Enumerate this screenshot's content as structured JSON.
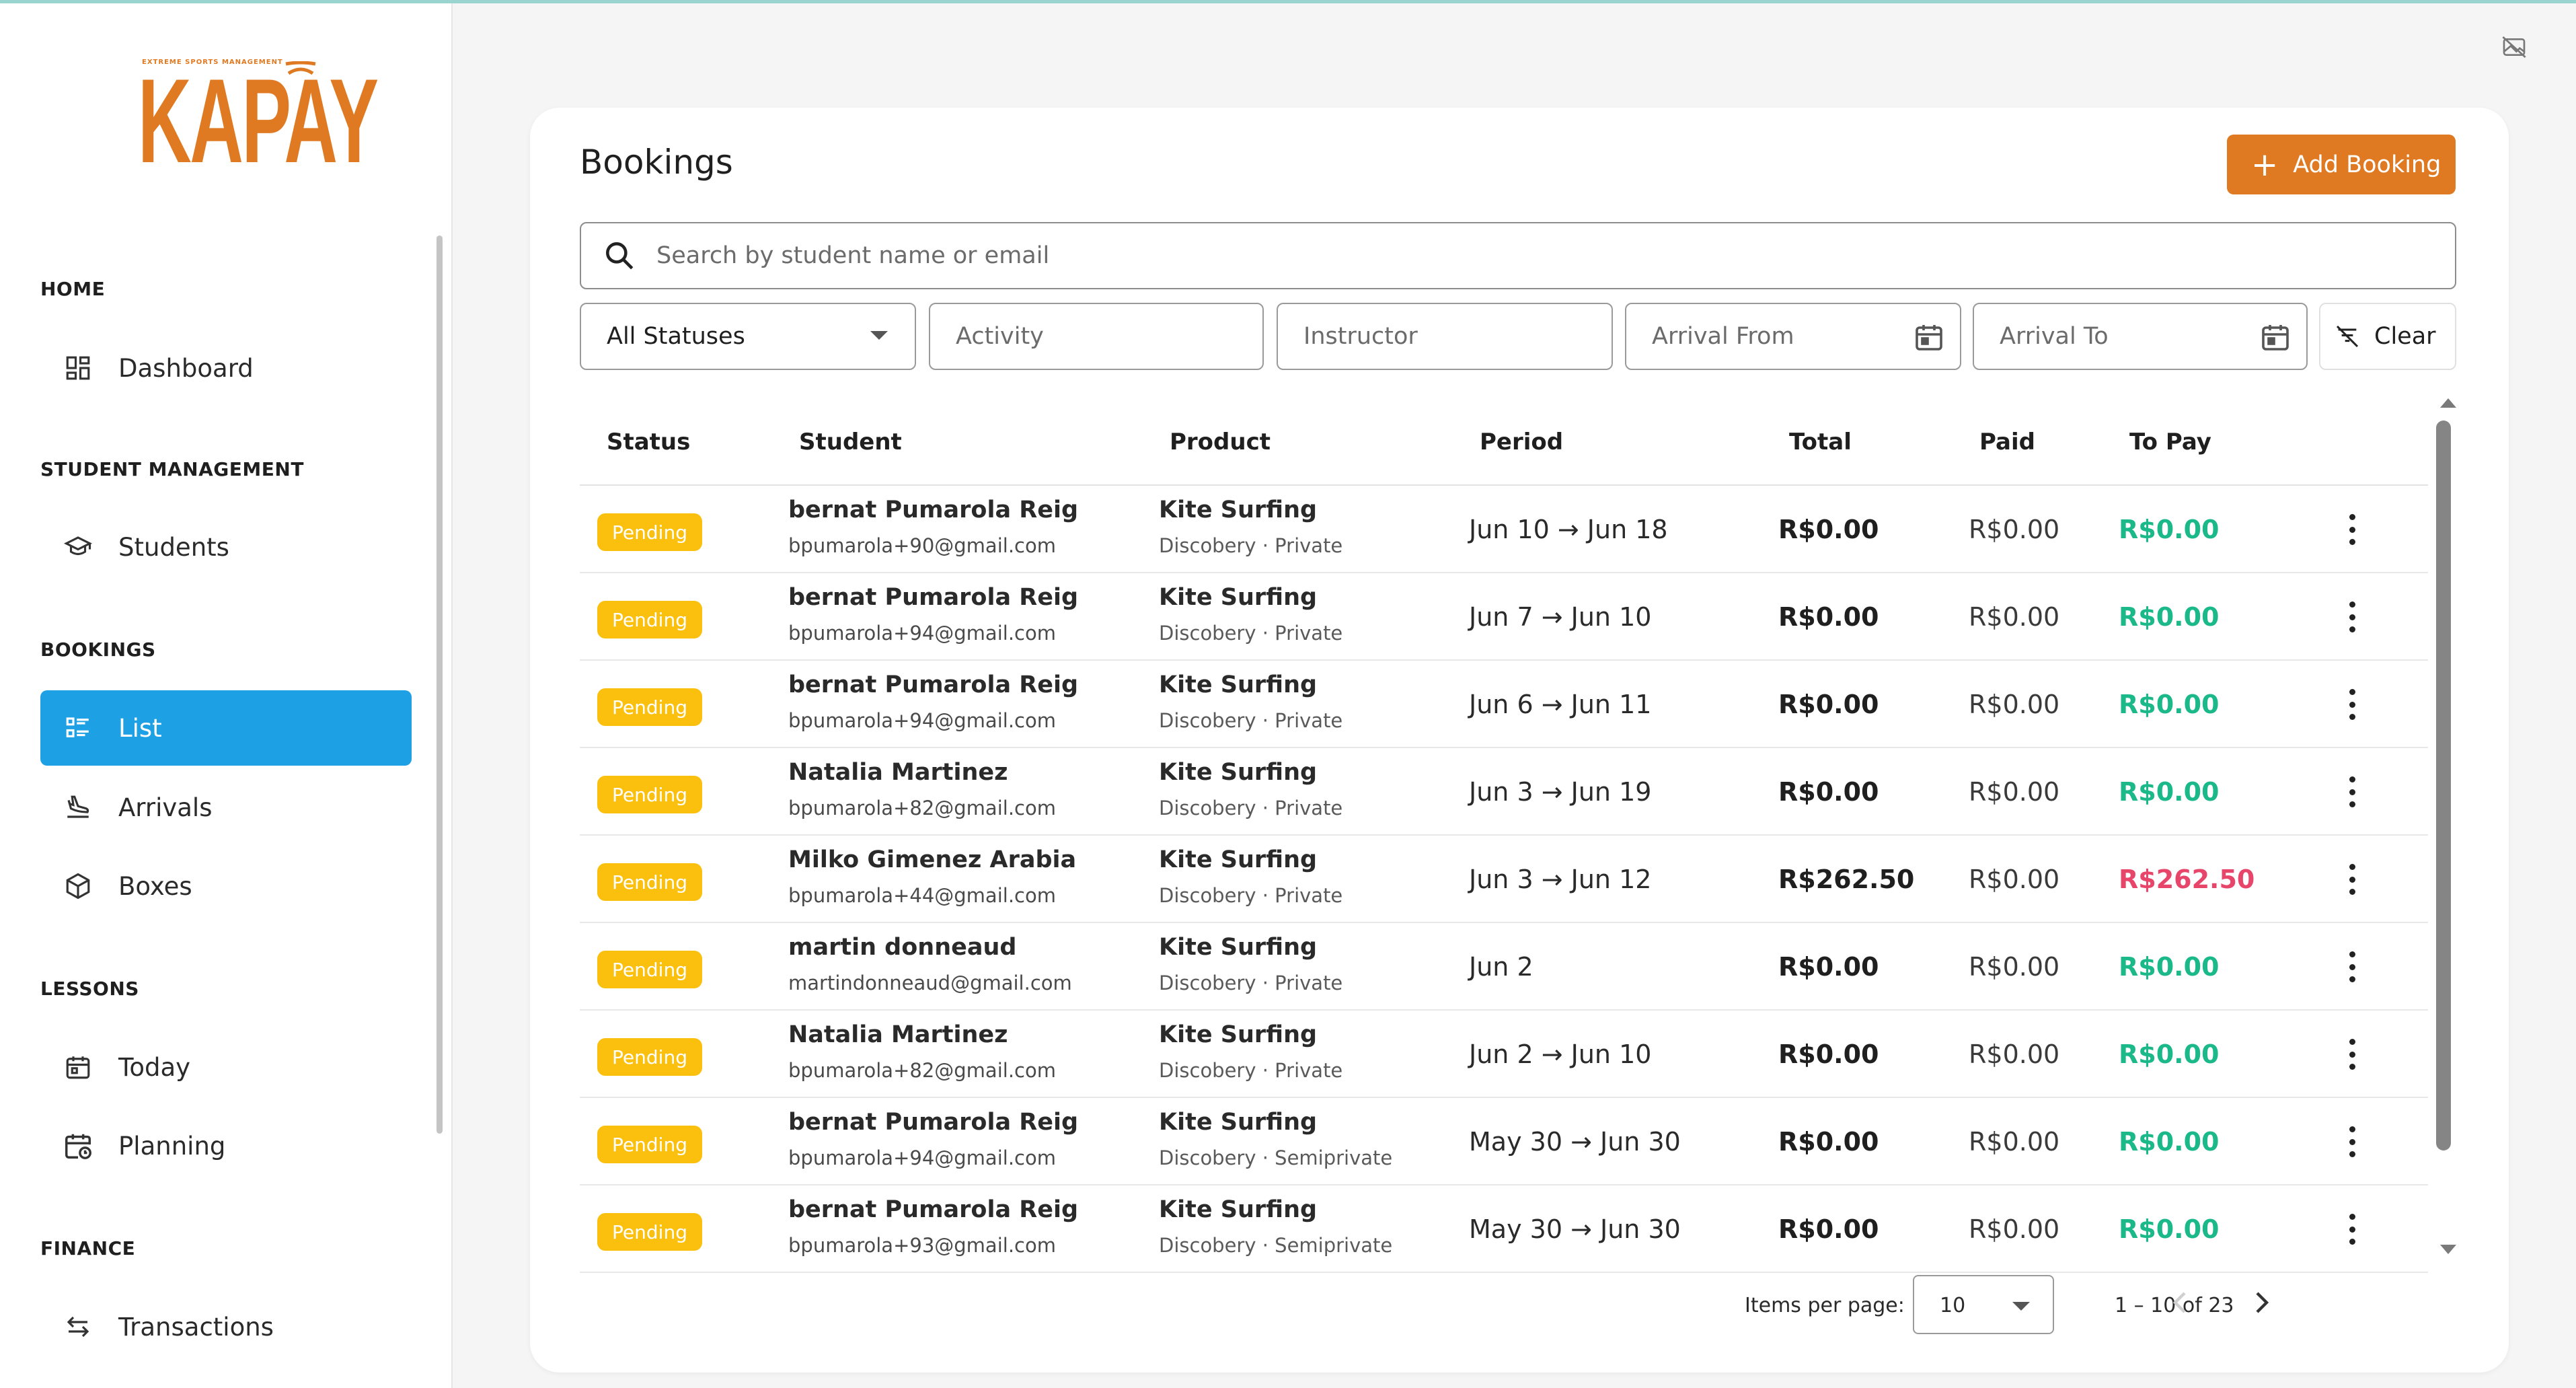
{
  "brand": {
    "tagline": "EXTREME SPORTS MANAGEMENT",
    "name": "KAPAY",
    "color": "#e07a22"
  },
  "sidebar": {
    "sections": [
      {
        "title": "HOME",
        "items": [
          {
            "label": "Dashboard",
            "icon": "dashboard-icon"
          }
        ]
      },
      {
        "title": "STUDENT MANAGEMENT",
        "items": [
          {
            "label": "Students",
            "icon": "graduation-cap-icon"
          }
        ]
      },
      {
        "title": "BOOKINGS",
        "items": [
          {
            "label": "List",
            "icon": "list-icon",
            "active": true
          },
          {
            "label": "Arrivals",
            "icon": "plane-landing-icon"
          },
          {
            "label": "Boxes",
            "icon": "box-icon"
          }
        ]
      },
      {
        "title": "LESSONS",
        "items": [
          {
            "label": "Today",
            "icon": "calendar-icon"
          },
          {
            "label": "Planning",
            "icon": "calendar-clock-icon"
          }
        ]
      },
      {
        "title": "FINANCE",
        "items": [
          {
            "label": "Transactions",
            "icon": "swap-arrows-icon"
          }
        ]
      }
    ]
  },
  "page": {
    "title": "Bookings",
    "add_button": "Add Booking",
    "search_placeholder": "Search by student name or email",
    "filters": {
      "status": "All Statuses",
      "activity": "Activity",
      "instructor": "Instructor",
      "arrival_from": "Arrival From",
      "arrival_to": "Arrival To",
      "clear": "Clear"
    }
  },
  "table": {
    "columns": [
      "Status",
      "Student",
      "Product",
      "Period",
      "Total",
      "Paid",
      "To Pay"
    ],
    "rows": [
      {
        "status": "Pending",
        "student": "bernat Pumarola Reig",
        "email": "bpumarola+90@gmail.com",
        "product": "Kite Surfing",
        "detail": "Discobery · Private",
        "period": "Jun 10 → Jun 18",
        "total": "R$0.00",
        "paid": "R$0.00",
        "to_pay": "R$0.00",
        "to_pay_color": "#1bb98a"
      },
      {
        "status": "Pending",
        "student": "bernat Pumarola Reig",
        "email": "bpumarola+94@gmail.com",
        "product": "Kite Surfing",
        "detail": "Discobery · Private",
        "period": "Jun 7 → Jun 10",
        "total": "R$0.00",
        "paid": "R$0.00",
        "to_pay": "R$0.00",
        "to_pay_color": "#1bb98a"
      },
      {
        "status": "Pending",
        "student": "bernat Pumarola Reig",
        "email": "bpumarola+94@gmail.com",
        "product": "Kite Surfing",
        "detail": "Discobery · Private",
        "period": "Jun 6 → Jun 11",
        "total": "R$0.00",
        "paid": "R$0.00",
        "to_pay": "R$0.00",
        "to_pay_color": "#1bb98a"
      },
      {
        "status": "Pending",
        "student": "Natalia Martinez",
        "email": "bpumarola+82@gmail.com",
        "product": "Kite Surfing",
        "detail": "Discobery · Private",
        "period": "Jun 3 → Jun 19",
        "total": "R$0.00",
        "paid": "R$0.00",
        "to_pay": "R$0.00",
        "to_pay_color": "#1bb98a"
      },
      {
        "status": "Pending",
        "student": "Milko Gimenez Arabia",
        "email": "bpumarola+44@gmail.com",
        "product": "Kite Surfing",
        "detail": "Discobery · Private",
        "period": "Jun 3 → Jun 12",
        "total": "R$262.50",
        "paid": "R$0.00",
        "to_pay": "R$262.50",
        "to_pay_color": "#e8456b"
      },
      {
        "status": "Pending",
        "student": "martin donneaud",
        "email": "martindonneaud@gmail.com",
        "product": "Kite Surfing",
        "detail": "Discobery · Private",
        "period": "Jun 2",
        "total": "R$0.00",
        "paid": "R$0.00",
        "to_pay": "R$0.00",
        "to_pay_color": "#1bb98a"
      },
      {
        "status": "Pending",
        "student": "Natalia Martinez",
        "email": "bpumarola+82@gmail.com",
        "product": "Kite Surfing",
        "detail": "Discobery · Private",
        "period": "Jun 2 → Jun 10",
        "total": "R$0.00",
        "paid": "R$0.00",
        "to_pay": "R$0.00",
        "to_pay_color": "#1bb98a"
      },
      {
        "status": "Pending",
        "student": "bernat Pumarola Reig",
        "email": "bpumarola+94@gmail.com",
        "product": "Kite Surfing",
        "detail": "Discobery · Semiprivate",
        "period": "May 30 → Jun 30",
        "total": "R$0.00",
        "paid": "R$0.00",
        "to_pay": "R$0.00",
        "to_pay_color": "#1bb98a"
      },
      {
        "status": "Pending",
        "student": "bernat Pumarola Reig",
        "email": "bpumarola+93@gmail.com",
        "product": "Kite Surfing",
        "detail": "Discobery · Semiprivate",
        "period": "May 30 → Jun 30",
        "total": "R$0.00",
        "paid": "R$0.00",
        "to_pay": "R$0.00",
        "to_pay_color": "#1bb98a"
      }
    ]
  },
  "pagination": {
    "label": "Items per page:",
    "per_page": "10",
    "range": "1 – 10 of 23"
  }
}
